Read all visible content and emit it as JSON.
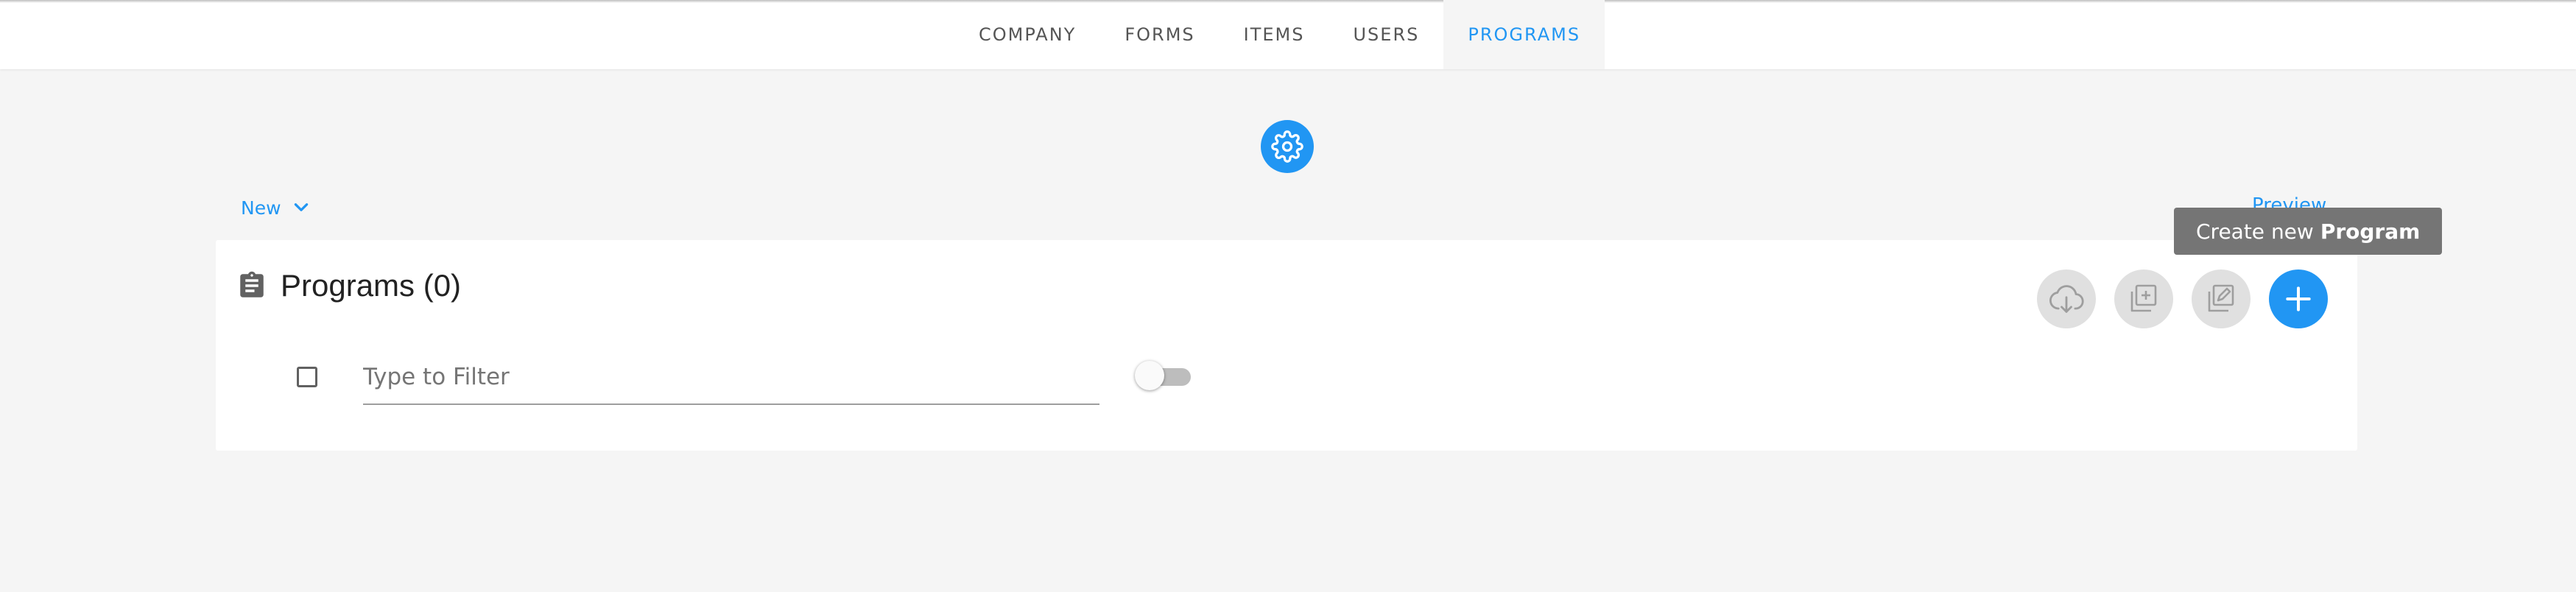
{
  "nav": {
    "tabs": [
      {
        "label": "COMPANY",
        "active": false
      },
      {
        "label": "FORMS",
        "active": false
      },
      {
        "label": "ITEMS",
        "active": false
      },
      {
        "label": "USERS",
        "active": false
      },
      {
        "label": "PROGRAMS",
        "active": true
      }
    ]
  },
  "settings": {
    "icon": "gear-icon"
  },
  "toolbar": {
    "new_label": "New",
    "preview_label": "Preview"
  },
  "card": {
    "title": "Programs (0)",
    "title_icon": "clipboard-icon",
    "filter_placeholder": "Type to Filter",
    "toggle_on": false,
    "actions": [
      {
        "icon": "cloud-download-icon",
        "enabled": false
      },
      {
        "icon": "duplicate-icon",
        "enabled": false
      },
      {
        "icon": "edit-copy-icon",
        "enabled": false
      },
      {
        "icon": "plus-icon",
        "enabled": true
      }
    ]
  },
  "tooltip": {
    "prefix": "Create new",
    "emphasis": "Program"
  },
  "colors": {
    "accent": "#2196f3",
    "background": "#f5f5f5",
    "tooltip_bg": "#757575",
    "disabled_btn": "#e0e0e0"
  }
}
